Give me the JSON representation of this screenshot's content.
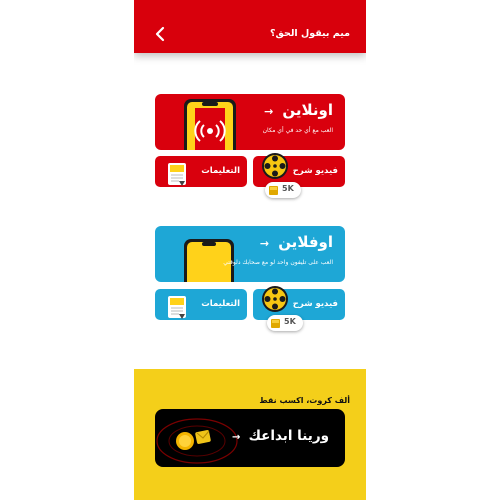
{
  "header": {
    "title": "ميم بيقول الحق؟"
  },
  "online": {
    "title": "اونلاين",
    "subtitle": "العب مع أي حد في أي مكان",
    "instructions_label": "التعليمات",
    "video_label": "فيديو شرح",
    "video_badge": "5K"
  },
  "offline": {
    "title": "اوفلاين",
    "subtitle": "العب على تليفون واحد لو مع صحابك دلوقتي",
    "instructions_label": "التعليمات",
    "video_label": "فيديو شرح",
    "video_badge": "5K"
  },
  "promo": {
    "caption": "ألف كروت، اكسب نقط",
    "button_label": "ورينا ابداعك"
  },
  "colors": {
    "red": "#d9000d",
    "blue": "#1ea7d6",
    "yellow": "#f4cf1a",
    "black": "#000000"
  }
}
